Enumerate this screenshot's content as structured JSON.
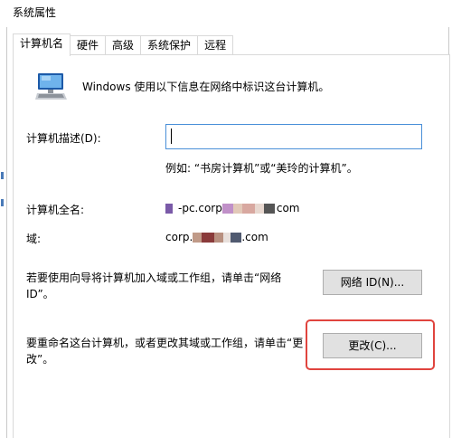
{
  "window": {
    "title": "系统属性"
  },
  "tabs": [
    {
      "label": "计算机名",
      "active": true
    },
    {
      "label": "硬件",
      "active": false
    },
    {
      "label": "高级",
      "active": false
    },
    {
      "label": "系统保护",
      "active": false
    },
    {
      "label": "远程",
      "active": false
    }
  ],
  "computer_name_tab": {
    "intro": "Windows 使用以下信息在网络中标识这台计算机。",
    "description_label": "计算机描述(D):",
    "description_value": "",
    "example": "例如: “书房计算机”或“美玲的计算机”。",
    "full_name_label": "计算机全名:",
    "full_name_prefix": "-pc.corp",
    "full_name_suffix": "com",
    "domain_label": "域:",
    "domain_prefix": "corp.",
    "domain_suffix": ".com",
    "wizard_text": "若要使用向导将计算机加入域或工作组，请单击“网络 ID”。",
    "network_id_button": "网络 ID(N)...",
    "rename_text": "要重命名这台计算机，或者更改其域或工作组，请单击“更改”。",
    "change_button": "更改(C)..."
  },
  "colors": {
    "highlight": "#e0443e",
    "input_border": "#4a8fd8",
    "button_bg": "#e1e1e1"
  }
}
